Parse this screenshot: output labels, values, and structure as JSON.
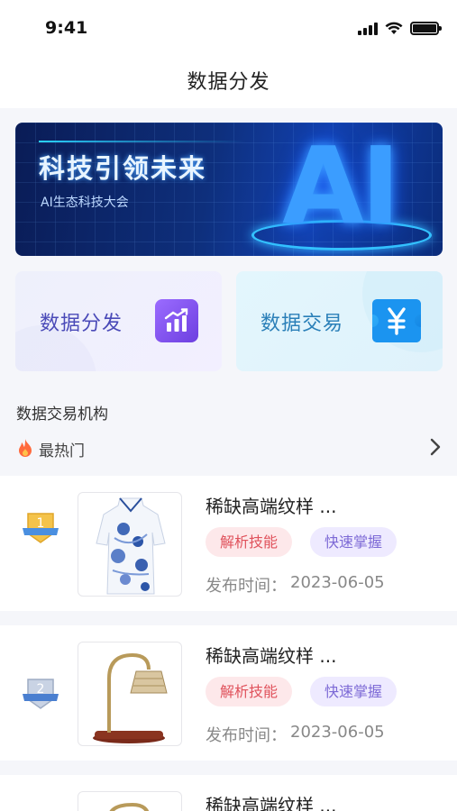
{
  "status_bar": {
    "time": "9:41"
  },
  "nav": {
    "title": "数据分发"
  },
  "banner": {
    "title": "科技引领未来",
    "subtitle": "AI生态科技大会",
    "big_text": "AI"
  },
  "cards": [
    {
      "label": "数据分发",
      "icon": "bar-chart-trend-icon",
      "accent": "#7a4cf0"
    },
    {
      "label": "数据交易",
      "icon": "yen-ticket-icon",
      "accent": "#1a90ee"
    }
  ],
  "section": {
    "title": "数据交易机构"
  },
  "hot": {
    "label": "最热门",
    "icon": "fire-icon"
  },
  "items": [
    {
      "rank": "1",
      "rank_badge": "gold-medal-icon",
      "title": "稀缺高端纹样 ...",
      "tags": [
        "解析技能",
        "快速掌握"
      ],
      "date_label": "发布时间：",
      "date": "2023-06-05",
      "image": "qipao-dress-image"
    },
    {
      "rank": "2",
      "rank_badge": "silver-medal-icon",
      "title": "稀缺高端纹样 ...",
      "tags": [
        "解析技能",
        "快速掌握"
      ],
      "date_label": "发布时间：",
      "date": "2023-06-05",
      "image": "table-lamp-image"
    },
    {
      "title": "稀缺高端纹样 ..."
    }
  ],
  "colors": {
    "tag_red": "#e0525c",
    "tag_purple": "#7d6ad6",
    "banner_blue": "#0e2f7c"
  }
}
